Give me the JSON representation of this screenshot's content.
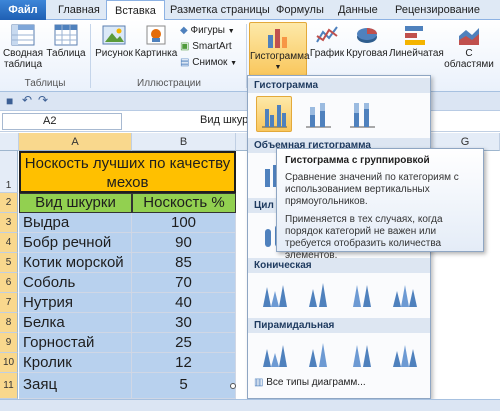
{
  "tabs": [
    {
      "label": "Файл"
    },
    {
      "label": "Главная"
    },
    {
      "label": "Вставка"
    },
    {
      "label": "Разметка страницы"
    },
    {
      "label": "Формулы"
    },
    {
      "label": "Данные"
    },
    {
      "label": "Рецензирование"
    }
  ],
  "ribbon": {
    "pivot_label": "Сводная таблица",
    "table_label": "Таблица",
    "tables_group": "Таблицы",
    "picture_label": "Рисунок",
    "clipart_label": "Картинка",
    "shapes_label": "Фигуры",
    "smartart_label": "SmartArt",
    "screenshot_label": "Снимок",
    "illustrations_group": "Иллюстрации",
    "histogram_label": "Гистограмма",
    "graph_label": "График",
    "pie_label": "Круговая",
    "bar_label": "Линейчатая",
    "area_label": "С областями"
  },
  "formula_bar": {
    "cell_ref": "A2",
    "content": "Вид шкур"
  },
  "sheet": {
    "columns": [
      "A",
      "B",
      "G"
    ],
    "rows": [
      "1",
      "2",
      "3",
      "4",
      "5",
      "6",
      "7",
      "8",
      "9",
      "10",
      "11"
    ],
    "title": "Носкость лучших по качеству мехов",
    "header_a": "Вид шкурки",
    "header_b": "Носкость %",
    "data": [
      {
        "name": "Выдра",
        "value": "100"
      },
      {
        "name": "Бобр речной",
        "value": "90"
      },
      {
        "name": "Котик морской",
        "value": "85"
      },
      {
        "name": "Соболь",
        "value": "70"
      },
      {
        "name": "Нутрия",
        "value": "40"
      },
      {
        "name": "Белка",
        "value": "30"
      },
      {
        "name": "Горностай",
        "value": "25"
      },
      {
        "name": "Кролик",
        "value": "12"
      },
      {
        "name": "Заяц",
        "value": "5"
      }
    ]
  },
  "dropdown": {
    "section1": "Гистограмма",
    "section2": "Объемная гистограмма",
    "section3_partial": "Цил",
    "section4": "Коническая",
    "section5": "Пирамидальная",
    "all_types": "Все типы диаграмм..."
  },
  "tooltip": {
    "title": "Гистограмма с группировкой",
    "text1": "Сравнение значений по категориям с использованием вертикальных прямоугольников.",
    "text2": "Применяется в тех случаях, когда порядок категорий не важен или требуется отобразить количества элементов."
  },
  "colors": {
    "title_fill": "#ffc000",
    "header_fill": "#92d050",
    "selection": "#b8d1ee",
    "accent": "#f9c75d"
  }
}
